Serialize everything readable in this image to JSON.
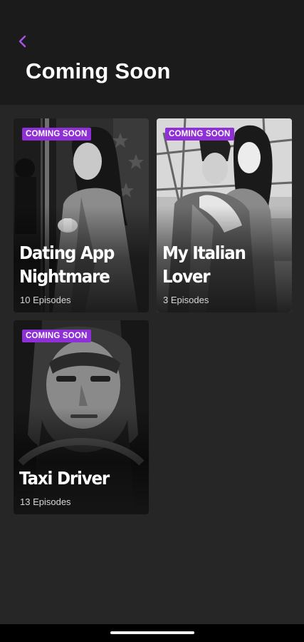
{
  "header": {
    "title": "Coming Soon",
    "back_icon": "chevron-left-icon"
  },
  "colors": {
    "accent": "#8f2fd6",
    "back_icon": "#a555e8",
    "background": "#262626",
    "header_background": "#1b1b1b"
  },
  "cards": [
    {
      "badge": "COMING SOON",
      "title": "Dating App Nightmare",
      "episodes": "10 Episodes"
    },
    {
      "badge": "COMING SOON",
      "title": "My Italian Lover",
      "episodes": "3 Episodes"
    },
    {
      "badge": "COMING SOON",
      "title": "Taxi Driver",
      "episodes": "13 Episodes"
    }
  ]
}
